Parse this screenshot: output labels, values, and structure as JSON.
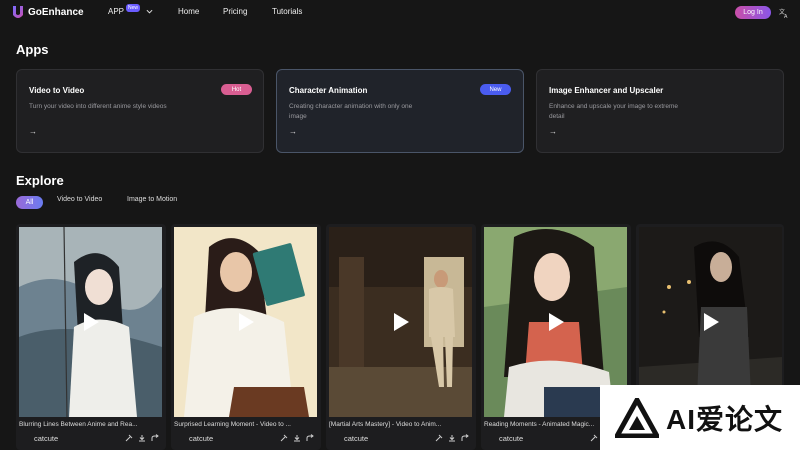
{
  "nav": {
    "brand": "GoEnhance",
    "app_label": "APP",
    "app_badge": "New",
    "home": "Home",
    "pricing": "Pricing",
    "tutorials": "Tutorials",
    "login": "Log In"
  },
  "apps": {
    "heading": "Apps",
    "cards": [
      {
        "title": "Video to Video",
        "desc": "Turn your video into different anime style videos",
        "badge": "Hot",
        "arrow": "→"
      },
      {
        "title": "Character Animation",
        "desc": "Creating character animation with only one image",
        "badge": "New",
        "arrow": "→"
      },
      {
        "title": "Image Enhancer and Upscaler",
        "desc": "Enhance and upscale your image to extreme detail",
        "arrow": "→"
      }
    ]
  },
  "explore": {
    "heading": "Explore",
    "filters": [
      "All",
      "Video to Video",
      "Image to Motion"
    ],
    "videos": [
      {
        "title": "Blurring Lines Between Anime and Rea...",
        "user": "catcute"
      },
      {
        "title": "Surprised Learning Moment - Video to ...",
        "user": "catcute"
      },
      {
        "title": "[Martial Arts Mastery] - Video to Anim...",
        "user": "catcute"
      },
      {
        "title": "Reading Moments - Animated Magic...",
        "user": "catcute"
      },
      {
        "title": "",
        "user": ""
      }
    ]
  },
  "watermark": {
    "text": "AI爱论文"
  },
  "colors": {
    "accent_pink": "#d95e92",
    "accent_blue": "#4a5cf0",
    "background": "#161616"
  }
}
